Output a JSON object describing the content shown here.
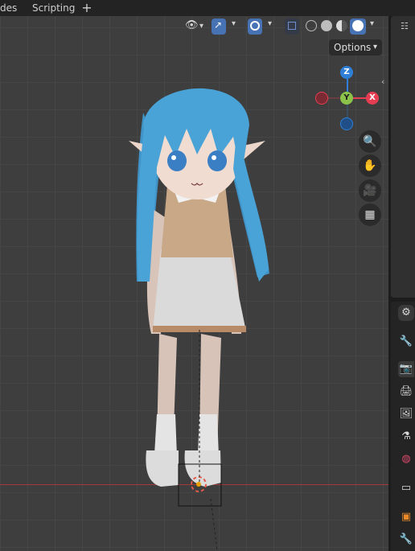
{
  "workspace_tabs": [
    {
      "label": "des"
    },
    {
      "label": "Scripting"
    }
  ],
  "add_tab_label": "+",
  "viewport": {
    "options_label": "Options",
    "gizmo": {
      "z": "Z",
      "y": "Y",
      "x": "X"
    }
  },
  "colors": {
    "accent": "#4772b3",
    "axis_x": "#e53e52",
    "axis_y": "#8bc34a",
    "axis_z": "#2f7fd8",
    "hair": "#4aa3d6",
    "grid": "#3e3e3e",
    "red_axis_line": "#a33a3a"
  },
  "icons": {
    "header": [
      "eye-visibility-icon",
      "gizmo-icon",
      "overlay-icon",
      "xray-icon",
      "wireframe-shading-icon",
      "solid-shading-icon",
      "material-shading-icon",
      "rendered-shading-icon"
    ],
    "navigation": [
      "zoom-icon",
      "pan-hand-icon",
      "camera-view-icon",
      "ortho-grid-icon"
    ],
    "properties": [
      "tool-icon",
      "render-icon",
      "output-icon",
      "view-layer-icon",
      "scene-icon",
      "world-icon",
      "collection-icon",
      "object-icon",
      "modifier-wrench-icon"
    ]
  }
}
